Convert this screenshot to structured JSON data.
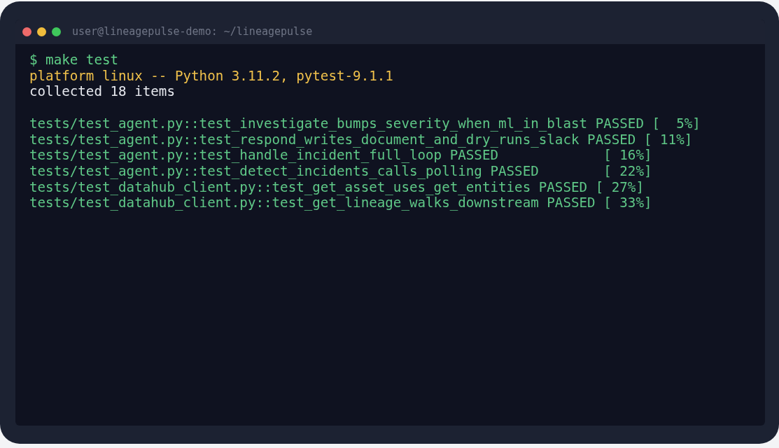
{
  "window": {
    "title": "user@lineagepulse-demo: ~/lineagepulse",
    "buttons": [
      {
        "color": "#ee6a6a"
      },
      {
        "color": "#f1bd3c"
      },
      {
        "color": "#3fc75b"
      }
    ]
  },
  "terminal": {
    "lines": [
      {
        "kind": "command",
        "text": "$ make test"
      },
      {
        "kind": "info",
        "text": "platform linux -- Python 3.11.2, pytest-9.1.1"
      },
      {
        "kind": "plain",
        "text": "collected 18 items"
      },
      {
        "kind": "blank"
      },
      {
        "kind": "result",
        "text": "tests/test_agent.py::test_investigate_bumps_severity_when_ml_in_blast PASSED [  5%]"
      },
      {
        "kind": "result",
        "text": "tests/test_agent.py::test_respond_writes_document_and_dry_runs_slack PASSED [ 11%]"
      },
      {
        "kind": "result",
        "text": "tests/test_agent.py::test_handle_incident_full_loop PASSED             [ 16%]"
      },
      {
        "kind": "result",
        "text": "tests/test_agent.py::test_detect_incidents_calls_polling PASSED        [ 22%]"
      },
      {
        "kind": "result",
        "text": "tests/test_datahub_client.py::test_get_asset_uses_get_entities PASSED [ 27%]"
      },
      {
        "kind": "result",
        "text": "tests/test_datahub_client.py::test_get_lineage_walks_downstream PASSED [ 33%]"
      }
    ]
  }
}
